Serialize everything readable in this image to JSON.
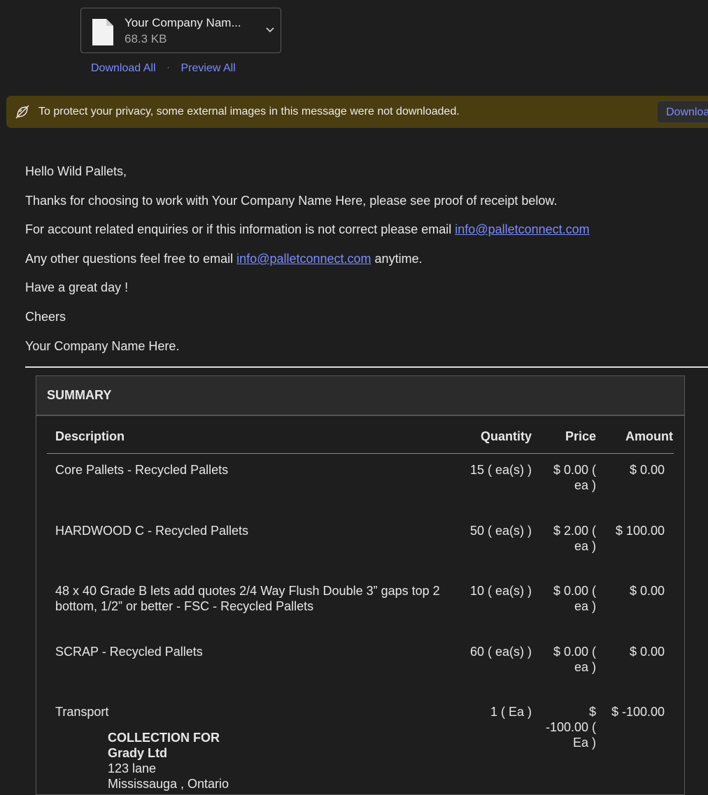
{
  "attachment": {
    "file_name": "Your Company Nam...",
    "file_size": "68.3 KB",
    "download_all": "Download All",
    "separator": "·",
    "preview_all": "Preview All"
  },
  "privacy_banner": {
    "text": "To protect your privacy, some external images in this message were not downloaded.",
    "button": "Download"
  },
  "message": {
    "greeting": "Hello Wild Pallets,",
    "line1": "Thanks for choosing to work with Your Company Name Here, please see proof of receipt below.",
    "line2_prefix": "For account related enquiries or if this information is not correct please email ",
    "email": "info@palletconnect.com",
    "line3_prefix": "Any other questions feel free to email ",
    "line3_suffix": " anytime.",
    "line4": "Have a great day !",
    "line5": "Cheers",
    "signature": "Your Company Name Here."
  },
  "summary": {
    "title": "SUMMARY",
    "headers": {
      "description": "Description",
      "quantity": "Quantity",
      "price": "Price",
      "amount": "Amount"
    },
    "rows": [
      {
        "description": "Core Pallets - Recycled Pallets",
        "quantity": "15 ( ea(s) )",
        "price": "$ 0.00 ( ea )",
        "amount": "$ 0.00"
      },
      {
        "description": "HARDWOOD C - Recycled Pallets",
        "quantity": "50 ( ea(s) )",
        "price": "$ 2.00 ( ea )",
        "amount": "$ 100.00"
      },
      {
        "description": "48 x 40 Grade B lets add quotes 2/4 Way Flush Double 3” gaps top 2 bottom, 1/2” or better - FSC - Recycled Pallets",
        "quantity": "10 ( ea(s) )",
        "price": "$ 0.00 ( ea )",
        "amount": "$ 0.00"
      },
      {
        "description": "SCRAP - Recycled Pallets",
        "quantity": "60 ( ea(s) )",
        "price": "$ 0.00 ( ea )",
        "amount": "$ 0.00"
      },
      {
        "description": "Transport",
        "quantity": "1 ( Ea )",
        "price": "$ -100.00 ( Ea )",
        "amount": "$ -100.00"
      }
    ],
    "collection": {
      "label": "COLLECTION FOR",
      "company": "Grady Ltd",
      "street": "123 lane",
      "city": "Mississauga , Ontario"
    }
  }
}
